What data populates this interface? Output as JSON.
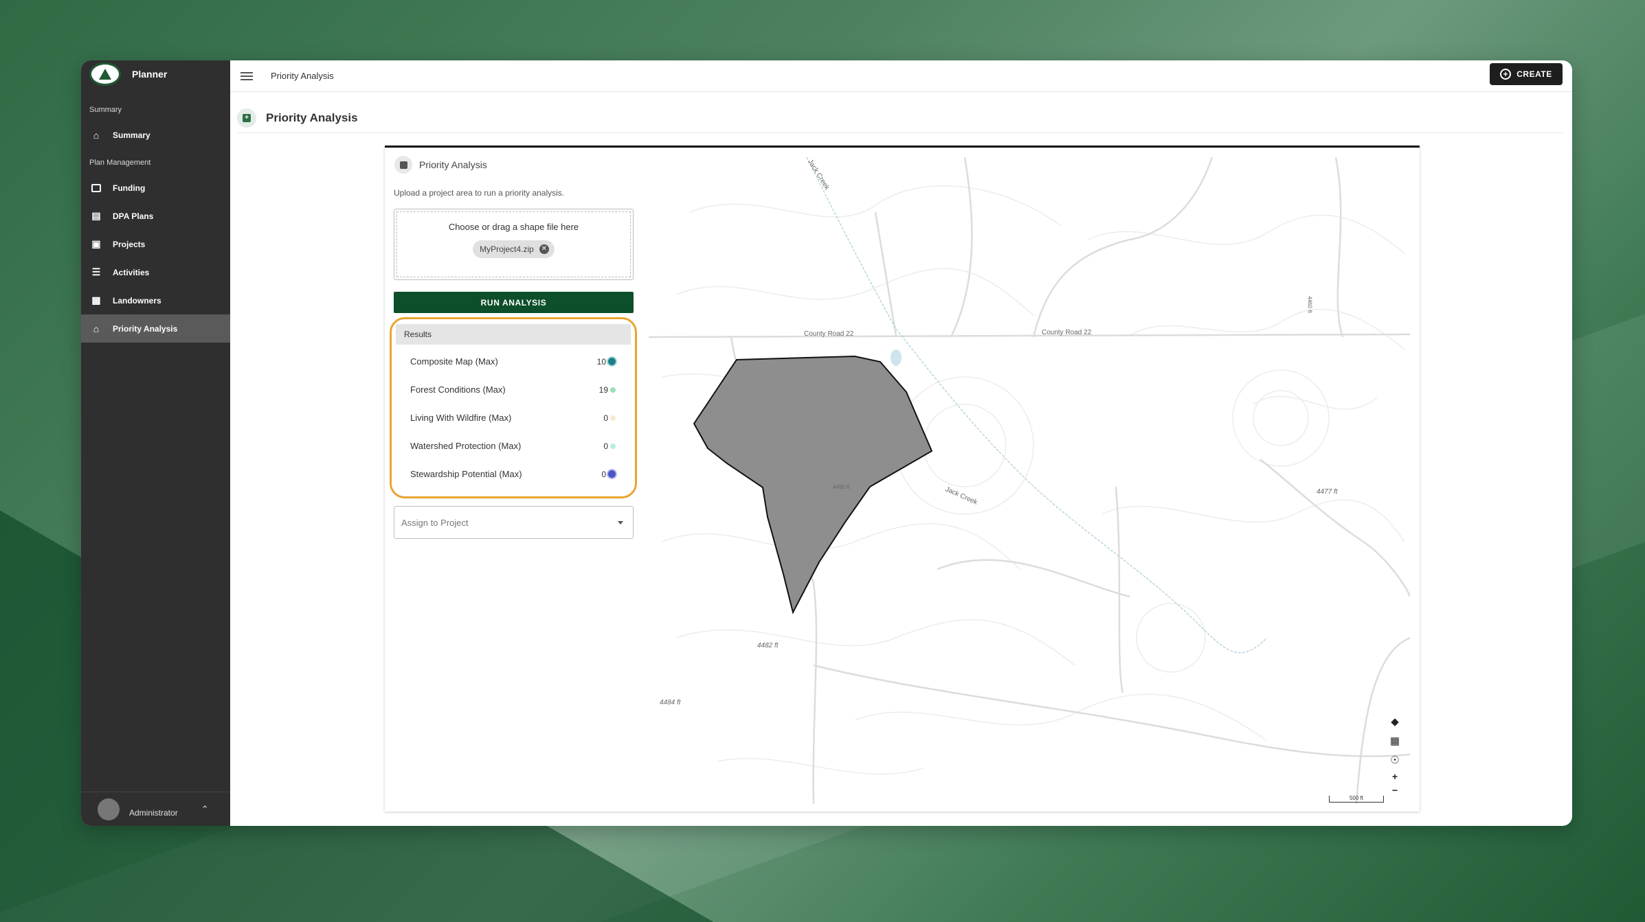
{
  "app": {
    "brand_title": "Planner",
    "topbar_title": "Priority Analysis",
    "create_label": "CREATE",
    "page_title": "Priority Analysis"
  },
  "sidebar": {
    "section_summary": "Summary",
    "section_plan": "Plan Management",
    "items": [
      {
        "label": "Summary",
        "icon": "home-icon"
      },
      {
        "label": "Funding",
        "icon": "money-icon"
      },
      {
        "label": "DPA Plans",
        "icon": "library-icon"
      },
      {
        "label": "Projects",
        "icon": "clipboard-icon"
      },
      {
        "label": "Activities",
        "icon": "checklist-icon"
      },
      {
        "label": "Landowners",
        "icon": "contact-icon"
      },
      {
        "label": "Priority Analysis",
        "icon": "home-icon",
        "active": true
      }
    ],
    "user_role": "Administrator"
  },
  "panel": {
    "title": "Priority Analysis",
    "description": "Upload a project area to run a priority analysis.",
    "dropzone_text": "Choose or drag a shape file here",
    "file_chip": "MyProject4.zip",
    "run_label": "RUN ANALYSIS",
    "results_title": "Results",
    "results": [
      {
        "name": "Composite Map (Max)",
        "value": "10",
        "color": "#1b7f8a"
      },
      {
        "name": "Forest Conditions (Max)",
        "value": "19",
        "color": "#9ee0b4"
      },
      {
        "name": "Living With Wildfire (Max)",
        "value": "0",
        "color": "#f5ead0"
      },
      {
        "name": "Watershed Protection (Max)",
        "value": "0",
        "color": "#b9ece4"
      },
      {
        "name": "Stewardship Potential (Max)",
        "value": "0",
        "color": "#4a56c8"
      }
    ],
    "assign_placeholder": "Assign to Project"
  },
  "map": {
    "labels": {
      "road1": "County Road 22",
      "road2": "County Road 22",
      "creek1": "Jack Creek",
      "creek2": "Jack Creek",
      "elev1": "4490 ft",
      "elev2": "4477 ft",
      "elev3": "4482 ft",
      "elev4": "4484 ft",
      "elev5": "4460 ft"
    },
    "scale_label": "500 ft",
    "zoom_in": "+",
    "zoom_out": "−",
    "polygon_fill": "#8e8e8e"
  }
}
